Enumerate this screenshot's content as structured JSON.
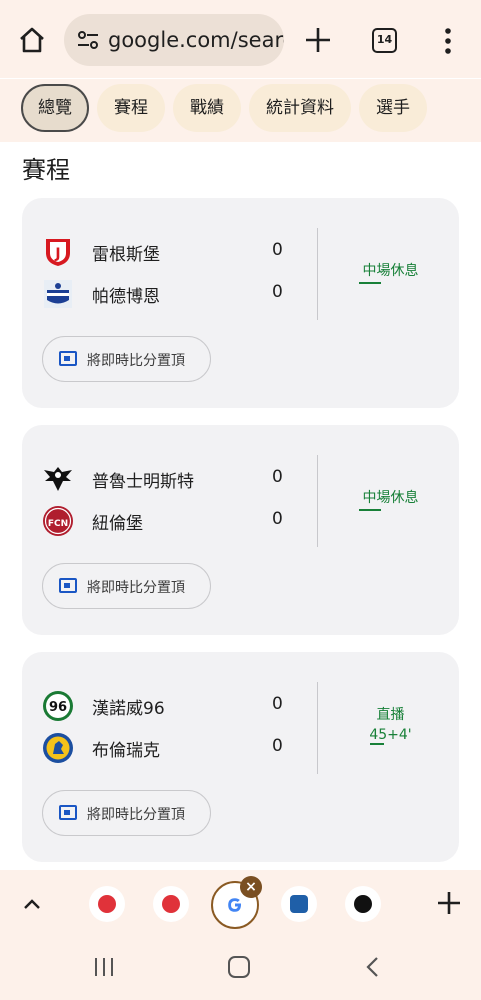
{
  "browser": {
    "url": "google.com/searc",
    "tab_count": "14"
  },
  "filters": [
    "總覽",
    "賽程",
    "戰績",
    "統計資料",
    "選手"
  ],
  "section_title": "賽程",
  "matches": [
    {
      "home": {
        "name": "雷根斯堡",
        "score": "0",
        "logo": "jahn-regensburg-logo"
      },
      "away": {
        "name": "帕德博恩",
        "score": "0",
        "logo": "paderborn-logo"
      },
      "status": "中場休息",
      "status_extra": "",
      "pin_label": "將即時比分置頂"
    },
    {
      "home": {
        "name": "普魯士明斯特",
        "score": "0",
        "logo": "preussen-muenster-logo"
      },
      "away": {
        "name": "紐倫堡",
        "score": "0",
        "logo": "nuernberg-logo"
      },
      "status": "中場休息",
      "status_extra": "",
      "pin_label": "將即時比分置頂"
    },
    {
      "home": {
        "name": "漢諾威96",
        "score": "0",
        "logo": "hannover-96-logo"
      },
      "away": {
        "name": "布倫瑞克",
        "score": "0",
        "logo": "braunschweig-logo"
      },
      "status": "直播",
      "status_extra": "45+4'",
      "pin_label": "將即時比分置頂"
    }
  ],
  "colors": {
    "toolbar_bg": "#fdf1ea",
    "chip_bg": "#f9ecd8",
    "card_bg": "#f2f2f4",
    "live_green": "#188038",
    "pin_blue": "#1a56c4"
  }
}
